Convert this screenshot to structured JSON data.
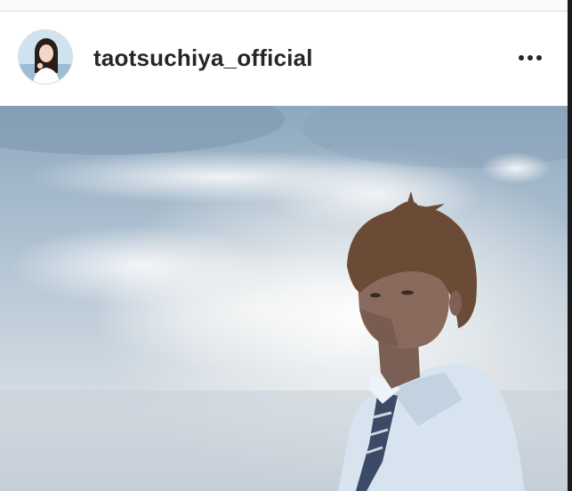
{
  "post": {
    "username": "taotsuchiya_official",
    "avatar_icon": "profile-avatar-icon",
    "more_icon": "more-options-icon",
    "more_label": "•••"
  },
  "photo": {
    "icon": "post-photo"
  },
  "colors": {
    "username_text": "#262626",
    "divider": "#dbdbdb",
    "sky_top": "#8ea8bf",
    "sky_bright": "#f2f3f2"
  }
}
